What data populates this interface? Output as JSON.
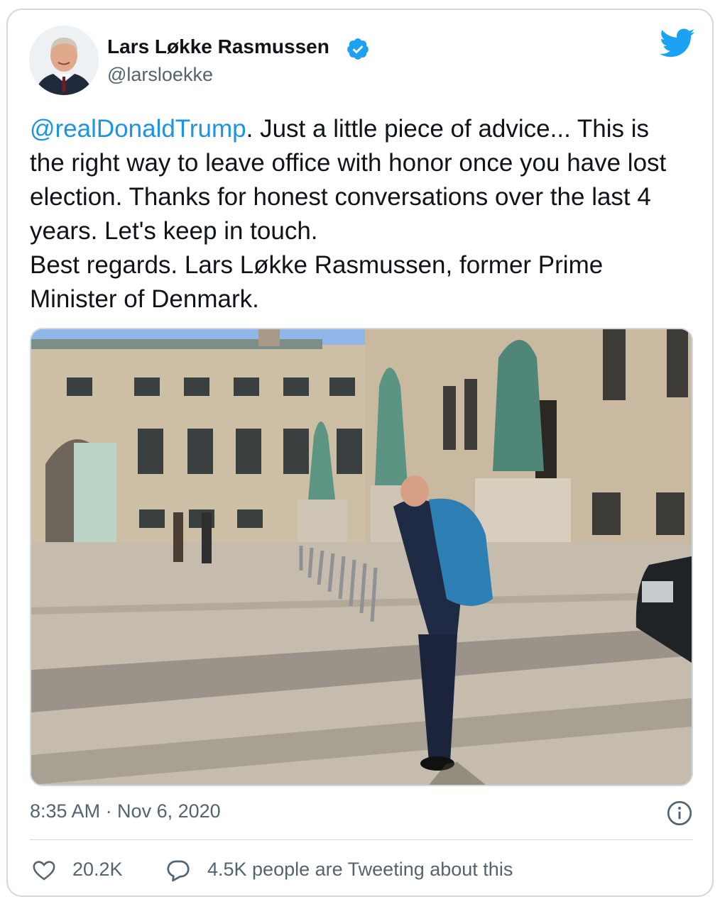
{
  "tweet": {
    "author": {
      "name": "Lars Løkke Rasmussen",
      "handle": "@larsloekke",
      "verified": true,
      "avatar_icon": "profile-photo"
    },
    "brand_icon": "twitter-bird-icon",
    "text": {
      "mention": "@realDonaldTrump",
      "line1_rest": ". Just a little piece of advice... This is the right way to leave office with honor once you have lost election. Thanks for honest conversations over the last 4 years. Let's keep in touch.",
      "line2": "Best regards. Lars Løkke Rasmussen, former Prime Minister of Denmark."
    },
    "media": {
      "type": "photo"
    },
    "timestamp": "8:35 AM · Nov 6, 2020",
    "stats": {
      "likes": "20.2K",
      "tweeting": "4.5K people are Tweeting about this"
    },
    "colors": {
      "link": "#1b95e0",
      "brand": "#1da1f2",
      "secondary_text": "#536471",
      "border": "#cfd9de"
    }
  }
}
